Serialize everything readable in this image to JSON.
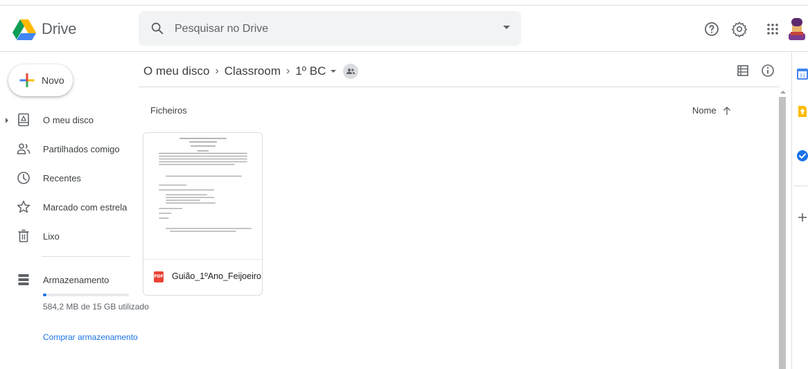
{
  "header": {
    "brand": "Drive",
    "search_placeholder": "Pesquisar no Drive",
    "icons": [
      "help-icon",
      "settings-icon",
      "apps-grid-icon",
      "account-avatar"
    ]
  },
  "sidebar": {
    "new_label": "Novo",
    "items": [
      {
        "label": "O meu disco",
        "icon": "drive-icon"
      },
      {
        "label": "Partilhados comigo",
        "icon": "people-icon"
      },
      {
        "label": "Recentes",
        "icon": "clock-icon"
      },
      {
        "label": "Marcado com estrela",
        "icon": "star-icon"
      },
      {
        "label": "Lixo",
        "icon": "trash-icon"
      }
    ],
    "storage_label": "Armazenamento",
    "storage_used_fraction": 0.04,
    "storage_text": "584,2 MB de 15 GB utilizado",
    "buy_storage": "Comprar armazenamento"
  },
  "breadcrumb": {
    "items": [
      "O meu disco",
      "Classroom",
      "1º BC"
    ]
  },
  "main": {
    "section_title": "Ficheiros",
    "sort_label": "Nome",
    "files": [
      {
        "name": "Guião_1ºAno_Feijoeiro.pdf",
        "type_badge": "PDF"
      }
    ]
  },
  "colors": {
    "accent": "#1a73e8",
    "pdf": "#ea4335",
    "search_bg": "#f1f3f4",
    "divider": "#dadce0"
  }
}
